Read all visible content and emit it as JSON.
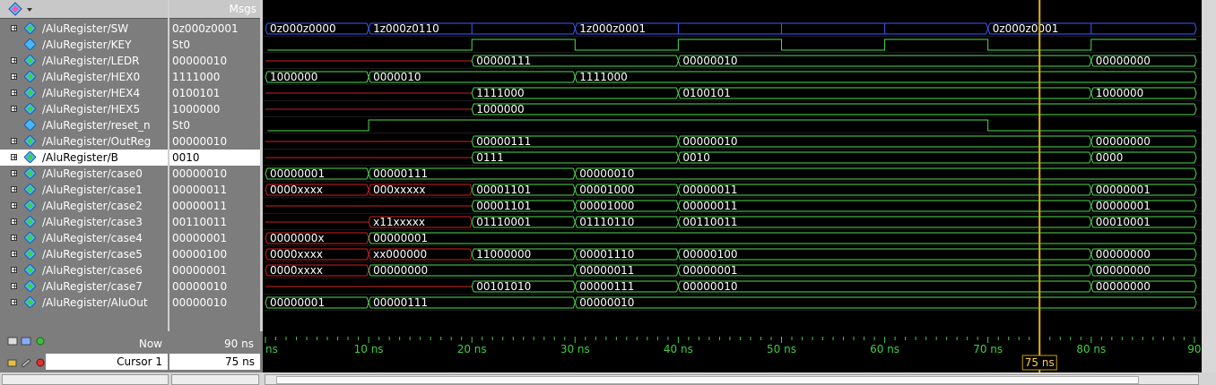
{
  "msgs_header": "Msgs",
  "signals": [
    {
      "name": "/AluRegister/SW",
      "value": "0z000z0001",
      "expand": true
    },
    {
      "name": "/AluRegister/KEY",
      "value": "St0",
      "expand": false
    },
    {
      "name": "/AluRegister/LEDR",
      "value": "00000010",
      "expand": true
    },
    {
      "name": "/AluRegister/HEX0",
      "value": "1111000",
      "expand": true
    },
    {
      "name": "/AluRegister/HEX4",
      "value": "0100101",
      "expand": true
    },
    {
      "name": "/AluRegister/HEX5",
      "value": "1000000",
      "expand": true
    },
    {
      "name": "/AluRegister/reset_n",
      "value": "St0",
      "expand": false
    },
    {
      "name": "/AluRegister/OutReg",
      "value": "00000010",
      "expand": true
    },
    {
      "name": "/AluRegister/B",
      "value": "0010",
      "expand": true
    },
    {
      "name": "/AluRegister/case0",
      "value": "00000010",
      "expand": true
    },
    {
      "name": "/AluRegister/case1",
      "value": "00000011",
      "expand": true
    },
    {
      "name": "/AluRegister/case2",
      "value": "00000011",
      "expand": true
    },
    {
      "name": "/AluRegister/case3",
      "value": "00110011",
      "expand": true
    },
    {
      "name": "/AluRegister/case4",
      "value": "00000001",
      "expand": true
    },
    {
      "name": "/AluRegister/case5",
      "value": "00000100",
      "expand": true
    },
    {
      "name": "/AluRegister/case6",
      "value": "00000001",
      "expand": true
    },
    {
      "name": "/AluRegister/case7",
      "value": "00000010",
      "expand": true
    },
    {
      "name": "/AluRegister/AluOut",
      "value": "00000010",
      "expand": true
    }
  ],
  "selected_index": 8,
  "waves": [
    {
      "type": "bus",
      "segs": [
        {
          "t": 0,
          "v": "0z000z0000"
        },
        {
          "t": 10,
          "v": "1z000z0110"
        },
        {
          "t": 30,
          "v": "1z000z0001"
        },
        {
          "t": 70,
          "v": "0z000z0001"
        }
      ],
      "ticks": [
        20,
        40,
        50,
        60,
        80
      ],
      "color": "#3a5cff"
    },
    {
      "type": "bit",
      "edges": [
        [
          0,
          "x"
        ],
        [
          0.2,
          0
        ],
        [
          20,
          1
        ],
        [
          30,
          0
        ],
        [
          40,
          1
        ],
        [
          50,
          0
        ],
        [
          60,
          1
        ],
        [
          70,
          0
        ],
        [
          80,
          1
        ]
      ]
    },
    {
      "type": "bus",
      "segs": [
        {
          "t": 0,
          "v": "",
          "red": true
        },
        {
          "t": 20,
          "v": "00000111"
        },
        {
          "t": 40,
          "v": "00000010"
        },
        {
          "t": 80,
          "v": "00000000"
        }
      ]
    },
    {
      "type": "bus",
      "segs": [
        {
          "t": 0,
          "v": "1000000"
        },
        {
          "t": 10,
          "v": "0000010"
        },
        {
          "t": 30,
          "v": "1111000"
        }
      ]
    },
    {
      "type": "bus",
      "segs": [
        {
          "t": 0,
          "v": "",
          "red": true
        },
        {
          "t": 20,
          "v": "1111000"
        },
        {
          "t": 40,
          "v": "0100101"
        },
        {
          "t": 80,
          "v": "1000000"
        }
      ]
    },
    {
      "type": "bus",
      "segs": [
        {
          "t": 0,
          "v": "",
          "red": true
        },
        {
          "t": 20,
          "v": "1000000"
        }
      ]
    },
    {
      "type": "bit",
      "edges": [
        [
          0,
          "x"
        ],
        [
          0.2,
          0
        ],
        [
          10,
          1
        ],
        [
          70,
          0
        ]
      ]
    },
    {
      "type": "bus",
      "segs": [
        {
          "t": 0,
          "v": "",
          "red": true
        },
        {
          "t": 20,
          "v": "00000111"
        },
        {
          "t": 40,
          "v": "00000010"
        },
        {
          "t": 80,
          "v": "00000000"
        }
      ]
    },
    {
      "type": "bus",
      "segs": [
        {
          "t": 0,
          "v": "",
          "red": true
        },
        {
          "t": 20,
          "v": "0111"
        },
        {
          "t": 40,
          "v": "0010"
        },
        {
          "t": 80,
          "v": "0000"
        }
      ]
    },
    {
      "type": "bus",
      "segs": [
        {
          "t": 0,
          "v": "00000001"
        },
        {
          "t": 10,
          "v": "00000111"
        },
        {
          "t": 30,
          "v": "00000010"
        }
      ]
    },
    {
      "type": "bus",
      "segs": [
        {
          "t": 0,
          "v": "0000xxxx",
          "red": true
        },
        {
          "t": 10,
          "v": "000xxxxx",
          "red": true
        },
        {
          "t": 20,
          "v": "00001101"
        },
        {
          "t": 30,
          "v": "00001000"
        },
        {
          "t": 40,
          "v": "00000011"
        },
        {
          "t": 80,
          "v": "00000001"
        }
      ]
    },
    {
      "type": "bus",
      "segs": [
        {
          "t": 0,
          "v": "",
          "red": true
        },
        {
          "t": 20,
          "v": "00001101"
        },
        {
          "t": 30,
          "v": "00001000"
        },
        {
          "t": 40,
          "v": "00000011"
        },
        {
          "t": 80,
          "v": "00000001"
        }
      ]
    },
    {
      "type": "bus",
      "segs": [
        {
          "t": 0,
          "v": "",
          "red": true
        },
        {
          "t": 10,
          "v": "x11xxxxx",
          "red": true
        },
        {
          "t": 20,
          "v": "01110001"
        },
        {
          "t": 30,
          "v": "01110110"
        },
        {
          "t": 40,
          "v": "00110011"
        },
        {
          "t": 80,
          "v": "00010001"
        }
      ]
    },
    {
      "type": "bus",
      "segs": [
        {
          "t": 0,
          "v": "0000000x",
          "red": true
        },
        {
          "t": 10,
          "v": "00000001"
        }
      ]
    },
    {
      "type": "bus",
      "segs": [
        {
          "t": 0,
          "v": "0000xxxx",
          "red": true
        },
        {
          "t": 10,
          "v": "xx000000",
          "red": true
        },
        {
          "t": 20,
          "v": "11000000"
        },
        {
          "t": 30,
          "v": "00001110"
        },
        {
          "t": 40,
          "v": "00000100"
        },
        {
          "t": 80,
          "v": "00000000"
        }
      ]
    },
    {
      "type": "bus",
      "segs": [
        {
          "t": 0,
          "v": "0000xxxx",
          "red": true
        },
        {
          "t": 10,
          "v": "00000000"
        },
        {
          "t": 30,
          "v": "00000011"
        },
        {
          "t": 40,
          "v": "00000001"
        },
        {
          "t": 80,
          "v": "00000000"
        }
      ]
    },
    {
      "type": "bus",
      "segs": [
        {
          "t": 0,
          "v": "",
          "red": true
        },
        {
          "t": 20,
          "v": "00101010"
        },
        {
          "t": 30,
          "v": "00000111"
        },
        {
          "t": 40,
          "v": "00000010"
        },
        {
          "t": 80,
          "v": "00000000"
        }
      ]
    },
    {
      "type": "bus",
      "segs": [
        {
          "t": 0,
          "v": "00000001"
        },
        {
          "t": 10,
          "v": "00000111"
        },
        {
          "t": 30,
          "v": "00000010"
        }
      ]
    }
  ],
  "timeline": {
    "t_min": 0,
    "t_max": 90.5,
    "labels": [
      "ns",
      "10 ns",
      "20 ns",
      "30 ns",
      "40 ns",
      "50 ns",
      "60 ns",
      "70 ns",
      "80 ns",
      "90"
    ],
    "label_times": [
      0,
      10,
      20,
      30,
      40,
      50,
      60,
      70,
      80,
      90
    ]
  },
  "now_label": "Now",
  "now_value": "90 ns",
  "cursor_label": "Cursor 1",
  "cursor_value": "75 ns",
  "cursor_time": 75,
  "cursor_tag": "75 ns"
}
